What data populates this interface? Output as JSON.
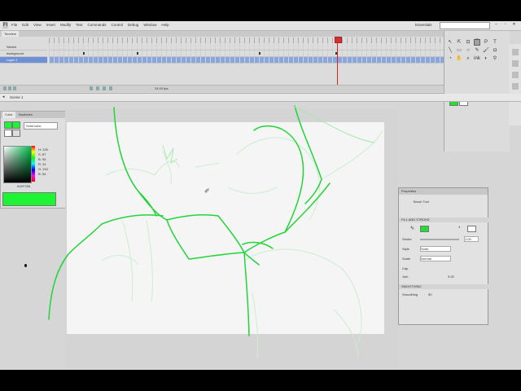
{
  "menubar": {
    "logo": "Fl",
    "menus": [
      "File",
      "Edit",
      "View",
      "Insert",
      "Modify",
      "Text",
      "Commands",
      "Control",
      "Debug",
      "Window",
      "Help"
    ],
    "workspace": "Essentials",
    "winbtns": [
      "–",
      "▫",
      "✕"
    ]
  },
  "timeline": {
    "tab_label": "Timeline",
    "layers": [
      "Sketch",
      "background",
      "Layer 1"
    ],
    "selected_layer": 2,
    "footer_value": "24.00 fps"
  },
  "editbar": {
    "scene": "Scene 1"
  },
  "tools": {
    "icons": [
      "↖",
      "⇱",
      "⊡",
      "⌒",
      "P",
      "T",
      "╲",
      "▭",
      "○",
      "✎",
      "🖌",
      "◘",
      "◔",
      "✋",
      "⌕",
      "ink",
      "◐",
      "⚲"
    ],
    "active_index": 3,
    "stroke_color": "#1fe02f",
    "fill_color": "#ffffff"
  },
  "colorpanel": {
    "tabs": [
      "Color",
      "Swatches"
    ],
    "type": "Solid color",
    "values": [
      "H: 128",
      "S: 87",
      "B: 95",
      "R: 31",
      "G: 243",
      "B: 54"
    ],
    "hex": "#1EF336",
    "alpha": "100%",
    "color": "#1ef336"
  },
  "props": {
    "title": "Properties",
    "tool": "Brush Tool",
    "section_fill": "FILL AND STROKE",
    "stroke_label": "Stroke",
    "stroke_value": "1.00",
    "style_label": "Style",
    "style_value": "Solid",
    "scale_label": "Scale",
    "scale_value": "Normal",
    "cap_label": "Cap",
    "join_label": "Join",
    "miter_value": "3.00",
    "section_smooth": "SMOOTHING",
    "smooth_label": "Smoothing",
    "smooth_value": "50",
    "accent": "#22dd33"
  }
}
